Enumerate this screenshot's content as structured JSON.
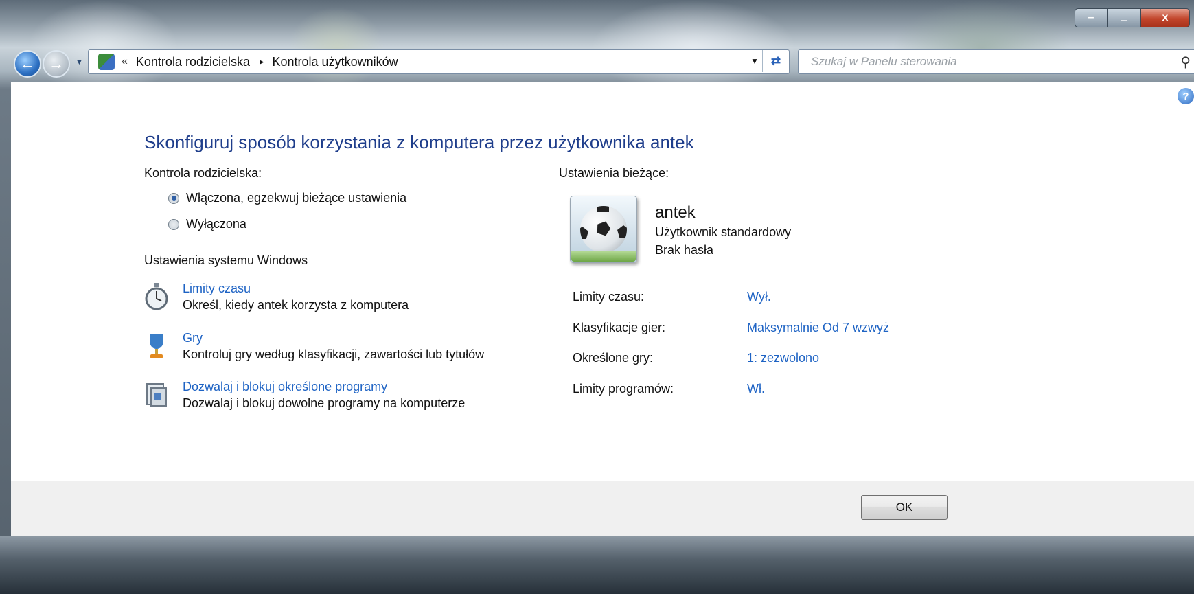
{
  "window": {
    "min_glyph": "–",
    "max_glyph": "□",
    "close_glyph": "x"
  },
  "nav": {
    "breadcrumbs": [
      "Kontrola rodzicielska",
      "Kontrola użytkowników"
    ],
    "overflow_glyph": "«",
    "separator_glyph": "▸",
    "search_placeholder": "Szukaj w Panelu sterowania"
  },
  "main": {
    "heading": "Skonfiguruj sposób korzystania z komputera przez użytkownika antek",
    "parental_label": "Kontrola rodzicielska:",
    "radio_on": "Włączona, egzekwuj bieżące ustawienia",
    "radio_off": "Wyłączona",
    "radio_selected": "on",
    "windows_settings_label": "Ustawienia systemu Windows",
    "tasks": [
      {
        "icon": "stopwatch-icon",
        "link": "Limity czasu",
        "desc": "Określ, kiedy antek korzysta z komputera"
      },
      {
        "icon": "trophy-icon",
        "link": "Gry",
        "desc": "Kontroluj gry według klasyfikacji, zawartości lub tytułów"
      },
      {
        "icon": "programs-icon",
        "link": "Dozwalaj i blokuj określone programy",
        "desc": "Dozwalaj i blokuj dowolne programy na komputerze"
      }
    ]
  },
  "current": {
    "label": "Ustawienia bieżące:",
    "user_name": "antek",
    "user_type": "Użytkownik standardowy",
    "user_password": "Brak hasła",
    "settings": [
      {
        "label": "Limity czasu:",
        "value": "Wył."
      },
      {
        "label": "Klasyfikacje gier:",
        "value": "Maksymalnie Od 7 wzwyż"
      },
      {
        "label": "Określone gry:",
        "value": "1: zezwolono"
      },
      {
        "label": "Limity programów:",
        "value": "Wł."
      }
    ]
  },
  "footer": {
    "ok_label": "OK"
  },
  "colors": {
    "heading": "#1e3d8b",
    "link": "#1e63c4"
  }
}
